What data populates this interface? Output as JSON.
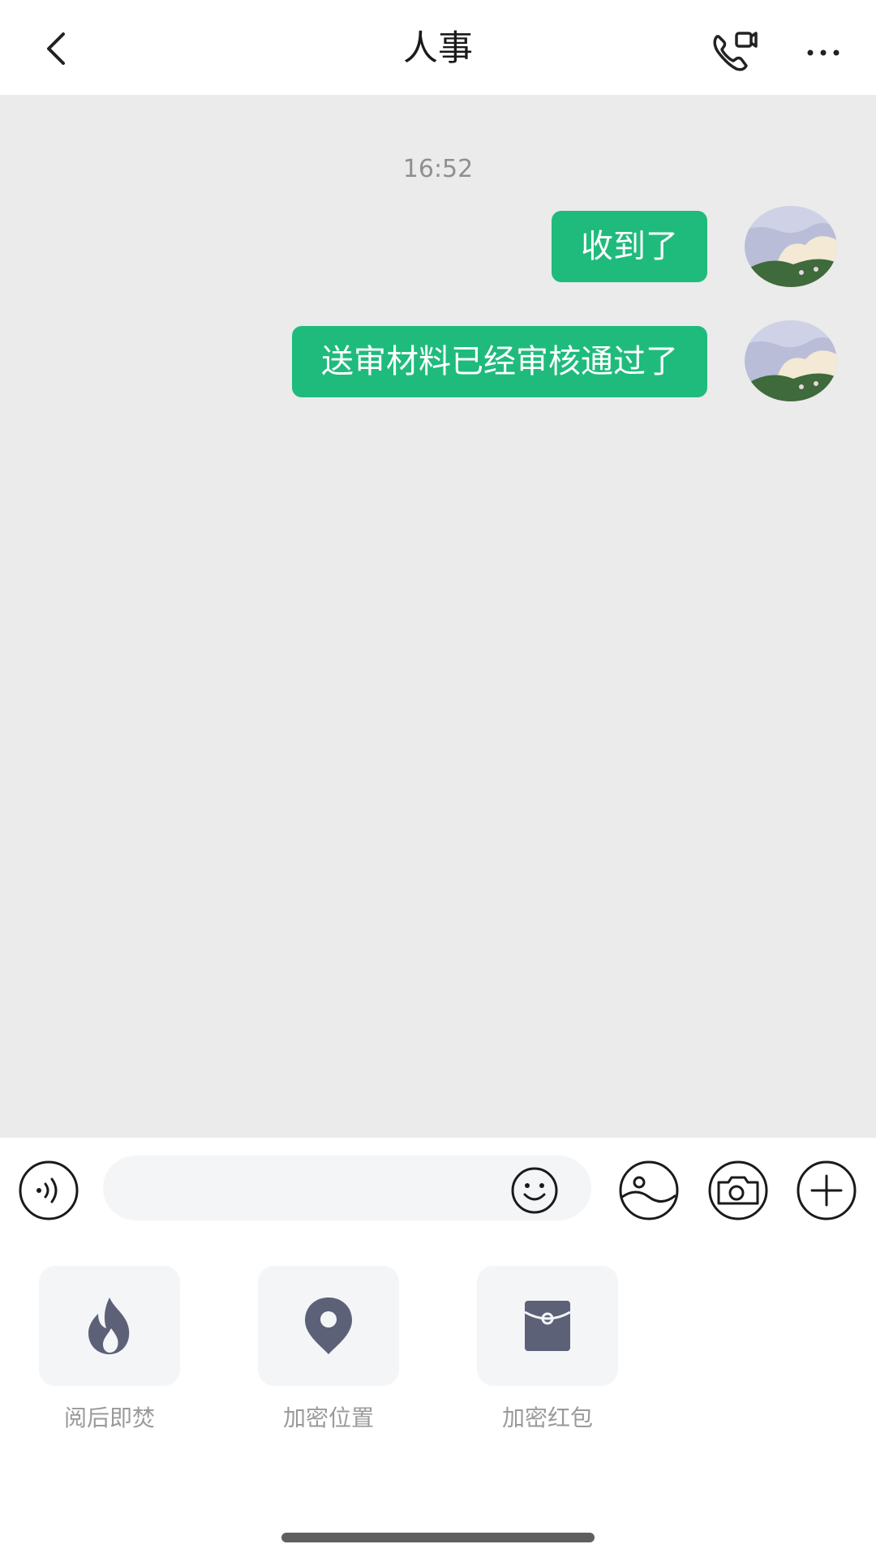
{
  "header": {
    "title": "人事",
    "back_icon": "chevron-left-icon",
    "call_icon": "phone-video-icon",
    "more_icon": "ellipsis-icon"
  },
  "chat": {
    "timestamp": "16:52",
    "messages": [
      {
        "text": "收到了",
        "sender": "self"
      },
      {
        "text": "送审材料已经审核通过了",
        "sender": "self"
      }
    ],
    "bubble_color": "#1fbb7c",
    "background_color": "#ebebeb"
  },
  "input_bar": {
    "placeholder": "",
    "voice_icon": "voice-icon",
    "emoji_icon": "emoji-icon",
    "image_icon": "image-icon",
    "camera_icon": "camera-icon",
    "plus_icon": "plus-icon"
  },
  "functions": [
    {
      "label": "阅后即焚",
      "icon": "flame-icon"
    },
    {
      "label": "加密位置",
      "icon": "location-pin-icon"
    },
    {
      "label": "加密红包",
      "icon": "red-packet-icon"
    }
  ],
  "colors": {
    "icon_dark": "#5d6178",
    "accent_green": "#1fbb7c"
  }
}
